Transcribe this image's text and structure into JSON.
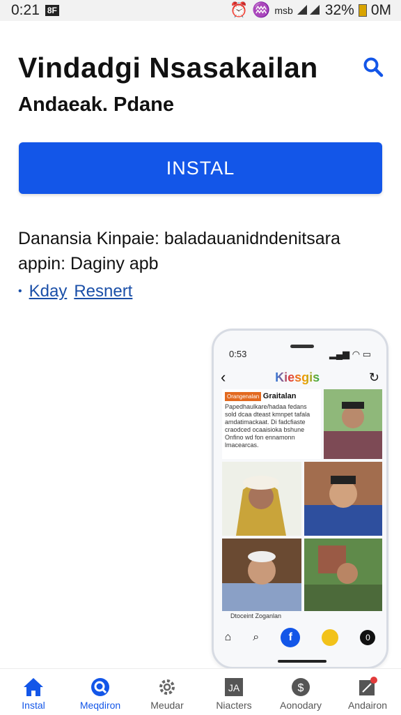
{
  "status_bar": {
    "time": "0:21",
    "box_label": "8F",
    "signal_text": "msb",
    "battery": "32%",
    "right_text": "0M"
  },
  "app": {
    "title": "Vindadgi Nsasakailan",
    "developer": "Andaeak. Pdane"
  },
  "install_button": {
    "label": "INSTAL"
  },
  "description": {
    "line1": "Danansia Kinpaie: baladauanidndenitsara",
    "line2": "appin: Daginy apb"
  },
  "link": {
    "bullet": "•",
    "text1": "Kday",
    "text2": "Resnert"
  },
  "phone": {
    "time": "0:53",
    "brand": "Kiesgis",
    "article_badge": "Orangenalan",
    "article_title": "Graitalan",
    "article_text": "Papedhaulkare/hadaa fedans sold dcaa dteast kmnpet tafala amdatimackaat. Di fadcfiaste craodced ocaaisioka bshune Onfino wd fon ennamonn lmacearcas.",
    "caption": "Dtoceint Zoganlan"
  },
  "bottom_nav": {
    "items": [
      {
        "label": "Instal",
        "icon": "home-icon"
      },
      {
        "label": "Meqdiron",
        "icon": "search-refresh-icon"
      },
      {
        "label": "Meudar",
        "icon": "gear-icon"
      },
      {
        "label": "Niacters",
        "icon": "news-icon"
      },
      {
        "label": "Aonodary",
        "icon": "dollar-circle-icon"
      },
      {
        "label": "Andairon",
        "icon": "edit-icon"
      }
    ]
  },
  "colors": {
    "accent": "#1356e8",
    "link": "#1a4fa8",
    "badge": "#e2691f"
  }
}
